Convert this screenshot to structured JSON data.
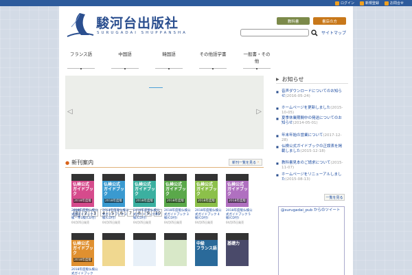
{
  "toplinks": [
    {
      "label": "ログイン",
      "icon": "login-icon"
    },
    {
      "label": "新規登録",
      "icon": "register-icon"
    },
    {
      "label": "お問合せ",
      "icon": "contact-icon"
    }
  ],
  "logo": {
    "jp": "駿河台出版社",
    "en": "SURUGADAI SHUPPANSHA"
  },
  "header_buttons": [
    {
      "label": "教科書",
      "color": "#7c8a4a"
    },
    {
      "label": "書店の方",
      "color": "#c8781a"
    }
  ],
  "search": {
    "placeholder": ""
  },
  "sitemap_label": "サイトマップ",
  "gnav": [
    "フランス語",
    "中国語",
    "韓国語",
    "その他語学書",
    "一般書・その他"
  ],
  "slider_pages": [
    "1",
    "2",
    "3",
    "4",
    "5",
    "6",
    "7",
    "8",
    "9",
    "10"
  ],
  "new_books": {
    "title": "新刊案内",
    "more_label": "新刊一覧を見る",
    "items": [
      {
        "cover_text": "仏検公式\nガイドブック",
        "year": "2018年度版",
        "color": "#d64b8c",
        "title": "2018年度版仏検公式ガイドブック 1級・準1級(CD付)",
        "date": "04月05日発売"
      },
      {
        "cover_text": "仏検公式\nガイドブック",
        "year": "2018年度版",
        "color": "#3a9ad0",
        "title": "2018年度版仏検公式ガイドブック 2級(CD付)",
        "date": "04月05日発売"
      },
      {
        "cover_text": "仏検公式\nガイドブック",
        "year": "2018年度版",
        "color": "#3bb0a0",
        "title": "2018年度版仏検公式ガイドブック準2級(CD付)",
        "date": "04月05日発売"
      },
      {
        "cover_text": "仏検公式\nガイドブック",
        "year": "2018年度版",
        "color": "#5aa84a",
        "title": "2018年度版仏検公式ガイドブック 3級(CD付)",
        "date": "04月05日発売"
      },
      {
        "cover_text": "仏検公式\nガイドブック",
        "year": "2018年度版",
        "color": "#8cc04a",
        "title": "2018年度版仏検公式ガイドブック 4級(CD付)",
        "date": "04月05日発売"
      },
      {
        "cover_text": "仏検公式\nガイドブック",
        "year": "2018年度版",
        "color": "#b070c0",
        "title": "2018年度版仏検公式ガイドブック 5級(CD付)",
        "date": "04月05日発売"
      },
      {
        "cover_text": "仏検公式\nガイドブック",
        "year": "2018年度版",
        "color": "#e09030",
        "title": "2018年度版仏検公式ガイドブック",
        "date": ""
      },
      {
        "cover_text": "",
        "year": "",
        "color": "#f0d890",
        "title": "",
        "date": ""
      },
      {
        "cover_text": "",
        "year": "",
        "color": "#e8f0f8",
        "title": "",
        "date": ""
      },
      {
        "cover_text": "",
        "year": "",
        "color": "#d8e8c8",
        "title": "",
        "date": ""
      },
      {
        "cover_text": "中級\nフランス語",
        "year": "",
        "color": "#2a6a9a",
        "title": "",
        "date": ""
      },
      {
        "cover_text": "基礎力",
        "year": "",
        "color": "#4a4a6a",
        "title": "",
        "date": ""
      }
    ]
  },
  "notice": {
    "title": "お知らせ",
    "items": [
      {
        "text": "音声ダウンロードについてのお知らせ",
        "date": "(2016-05-24)"
      },
      {
        "text": "ホームページを更新しました",
        "date": "(2015-10-05)"
      },
      {
        "text": "夏季休業期間中の発送についてのお知らせ",
        "date": "(2014-05-01)"
      },
      {
        "text": "年末年始の営業について",
        "date": "(2017-12-28)"
      },
      {
        "text": "仏検公式ガイドブックの正誤表を掲載しました",
        "date": "(2015-12-18)"
      },
      {
        "text": "教科書見本のご請求について",
        "date": "(2015-11-07)"
      },
      {
        "text": "ホームページをリニューアルしました",
        "date": "(2015-08-13)"
      }
    ],
    "more_label": "一覧を見る"
  },
  "twitter": {
    "label": "@surugadai_pub からのツイート"
  }
}
